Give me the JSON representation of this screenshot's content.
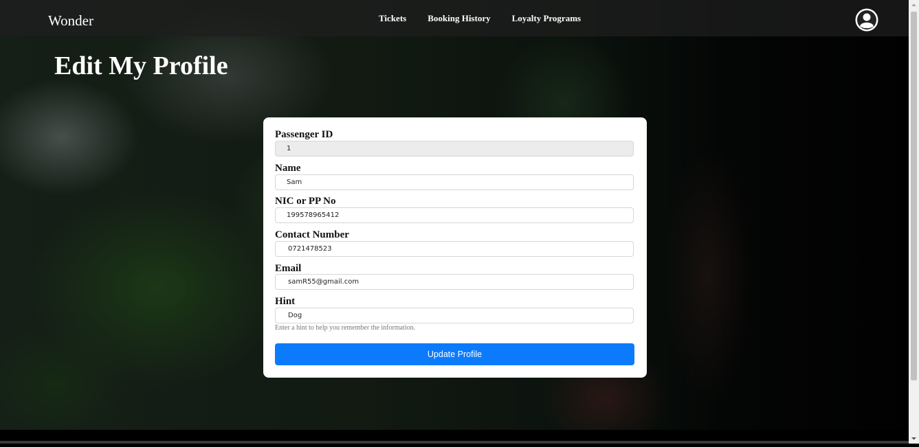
{
  "brand": "Wonder",
  "nav": {
    "links": [
      {
        "label": "Tickets"
      },
      {
        "label": "Booking History"
      },
      {
        "label": "Loyalty Programs"
      }
    ],
    "avatar_icon": "user-circle-icon"
  },
  "page": {
    "title": "Edit My Profile"
  },
  "form": {
    "fields": [
      {
        "label": "Passenger ID",
        "value": "1",
        "readonly": true
      },
      {
        "label": "Name",
        "value": "Sam"
      },
      {
        "label": "NIC or PP No",
        "value": "199578965412"
      },
      {
        "label": "Contact Number",
        "value": "0721478523"
      },
      {
        "label": "Email",
        "value": "samR55@gmail.com"
      },
      {
        "label": "Hint",
        "value": "Dog"
      }
    ],
    "hint_help": "Enter a hint to help you remember the information.",
    "submit_label": "Update Profile"
  },
  "colors": {
    "accent": "#0b7bfc",
    "navbar": "#1e1e1e",
    "card": "#ffffff"
  }
}
